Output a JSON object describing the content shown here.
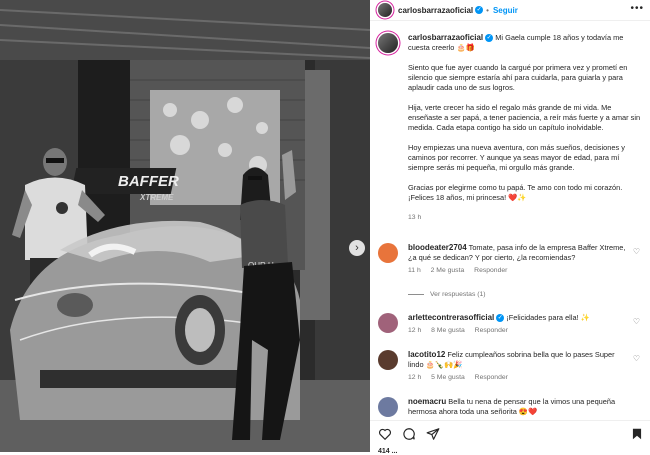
{
  "header": {
    "username": "carlosbarrazaoficial",
    "follow_label": "Seguir",
    "more_label": "•••"
  },
  "photo": {
    "brand_text": "BAFFER",
    "brand_sub": "XTREME",
    "shirt_text": "OUR U",
    "next_label": "›"
  },
  "caption": {
    "username": "carlosbarrazaoficial",
    "line1": "Mi Gaela cumple 18 años y todavía me cuesta creerlo 🎂🎁",
    "p1": "Siento que fue ayer cuando la cargué por primera vez y prometí en silencio que siempre estaría ahí para cuidarla, para guiarla y para aplaudir cada uno de sus logros.",
    "p2": "Hija, verte crecer ha sido el regalo más grande de mi vida. Me enseñaste a ser papá, a tener paciencia, a reír más fuerte y a amar sin medida. Cada etapa contigo ha sido un capítulo inolvidable.",
    "p3": "Hoy empiezas una nueva aventura, con más sueños, decisiones y caminos por recorrer. Y aunque ya seas mayor de edad, para mí siempre serás mi pequeña, mi orgullo más grande.",
    "p4": "Gracias por elegirme como tu papá. Te amo con todo mi corazón. ¡Felices 18 años, mi princesa! ❤️✨",
    "time": "13 h"
  },
  "comments": [
    {
      "username": "bloodeater2704",
      "text": "Tomate, pasa info de la empresa Baffer Xtreme, ¿a qué se dedican? Y por cierto, ¿la recomiendas?",
      "time": "11 h",
      "likes": "2 Me gusta",
      "reply": "Responder",
      "avatar_color": "#e8743b"
    },
    {
      "username": "arlettecontrerasofficial",
      "text": "¡Felicidades para ella! ✨",
      "time": "12 h",
      "likes": "8 Me gusta",
      "reply": "Responder",
      "avatar_color": "#a0627a"
    },
    {
      "username": "lacotito12",
      "text": "Feliz cumpleaños sobrina bella que lo pases Super lindo 🎂🍾🙌🎉",
      "time": "12 h",
      "likes": "5 Me gusta",
      "reply": "Responder",
      "avatar_color": "#5a3b2e"
    },
    {
      "username": "noemacru",
      "text": "Bella tu nena de pensar que la vimos una pequeña hermosa ahora toda una señorita 😍❤️",
      "time": "",
      "likes": "",
      "reply": "",
      "avatar_color": "#6d7aa0"
    }
  ],
  "view_replies": "Ver respuestas (1)",
  "likes_count": "414 ...",
  "colors": {
    "accent": "#0095f6",
    "verified": "#0095f6",
    "muted": "#737373"
  },
  "icons": [
    "heart-icon",
    "comment-icon",
    "share-icon",
    "bookmark-icon",
    "more-icon",
    "verified-icon"
  ]
}
